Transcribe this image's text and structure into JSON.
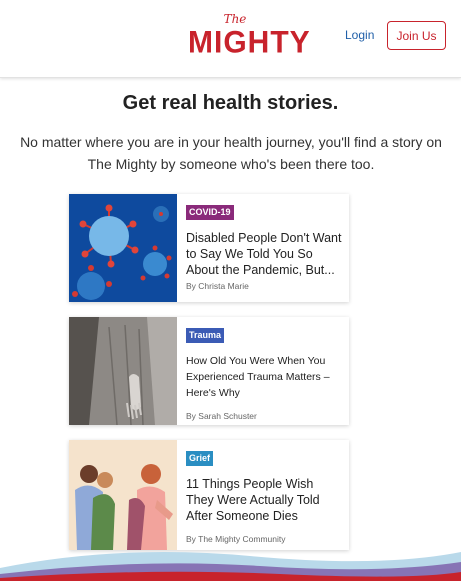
{
  "header": {
    "logo_the": "The",
    "logo_main": "MIGHTY",
    "login_label": "Login",
    "join_label": "Join Us"
  },
  "hero": {
    "headline": "Get real health stories.",
    "subtext": "No matter where you are in your health journey, you'll find a story on The Mighty by someone who's been there too."
  },
  "stories": [
    {
      "tag": "COVID-19",
      "tag_color": "#8a2a7a",
      "title": "Disabled People Don't Want to Say We Told You So About the Pandemic, But...",
      "author": "By Christa Marie",
      "image_icon": "coronavirus-image"
    },
    {
      "tag": "Trauma",
      "tag_color": "#3b5bb5",
      "title": "How Old You Were When You Experienced Trauma Matters – Here's Why",
      "author": "By Sarah Schuster",
      "image_icon": "child-hand-image"
    },
    {
      "tag": "Grief",
      "tag_color": "#2a8ec2",
      "title": "11 Things People Wish They Were Actually Told After Someone Dies",
      "author": "By The Mighty Community",
      "image_icon": "hugging-people-image"
    }
  ],
  "colors": {
    "brand_red": "#c8232c",
    "link_blue": "#1f5fa8"
  }
}
